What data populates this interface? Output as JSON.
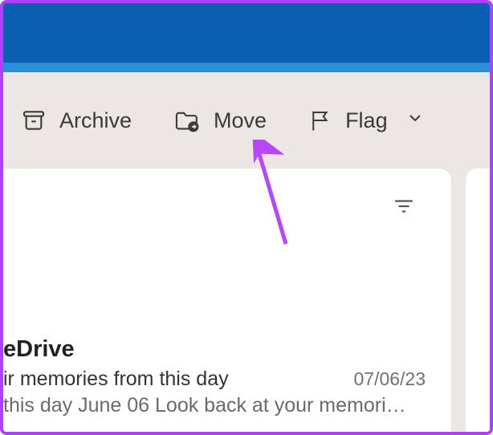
{
  "toolbar": {
    "archive_label": "Archive",
    "move_label": "Move",
    "flag_label": "Flag"
  },
  "mail": {
    "sender_partial": "eDrive",
    "subject_partial": "ir memories from this day",
    "date": "07/06/23",
    "preview_partial": " this day June 06 Look back at your memori…"
  },
  "annotation": {
    "arrow_color": "#b846ff",
    "border_color": "#b040ff"
  }
}
